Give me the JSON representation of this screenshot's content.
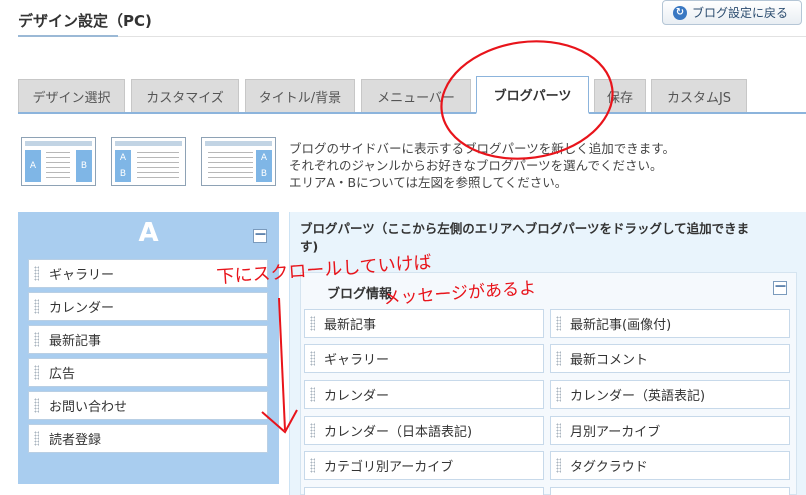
{
  "header": {
    "title": "デザイン設定（PC)",
    "back_button": "ブログ設定に戻る"
  },
  "tabs": [
    {
      "label": "デザイン選択"
    },
    {
      "label": "カスタマイズ"
    },
    {
      "label": "タイトル/背景"
    },
    {
      "label": "メニューバー"
    },
    {
      "label": "ブログパーツ",
      "active": true
    },
    {
      "label": "保存"
    },
    {
      "label": "カスタムJS"
    }
  ],
  "layout_diagrams": [
    {
      "cols": [
        "A",
        "B"
      ]
    },
    {
      "cols": [
        "A",
        "B"
      ]
    },
    {
      "cols": [
        "A",
        "B"
      ]
    }
  ],
  "description": [
    "ブログのサイドバーに表示するブログパーツを新しく追加できます。",
    "それぞれのジャンルからお好きなブログパーツを選んでください。",
    "エリアA・Bについては左図を参照してください。"
  ],
  "area_a": {
    "title": "A",
    "collapse": "－",
    "items": [
      "ギャラリー",
      "カレンダー",
      "最新記事",
      "広告",
      "お問い合わせ",
      "読者登録"
    ]
  },
  "parts_panel": {
    "title_line1": "ブログパーツ（ここから左側のエリアへブログパーツをドラッグして追加できま",
    "title_line2": "す)",
    "group_title": "ブログ情報",
    "collapse": "－",
    "items": [
      "最新記事",
      "最新記事(画像付)",
      "ギャラリー",
      "最新コメント",
      "カレンダー",
      "カレンダー（英語表記)",
      "カレンダー（日本語表記)",
      "月別アーカイブ",
      "カテゴリ別アーカイブ",
      "タグクラウド"
    ]
  },
  "annotation": {
    "line1": "下にスクロールしていけば",
    "line2": "メッセージがあるよ",
    "color": "#e8141b"
  },
  "colors": {
    "tab_active_border": "#8cb4dc",
    "area_a_bg": "#a9cdef",
    "parts_bg": "#e9f4fc"
  }
}
